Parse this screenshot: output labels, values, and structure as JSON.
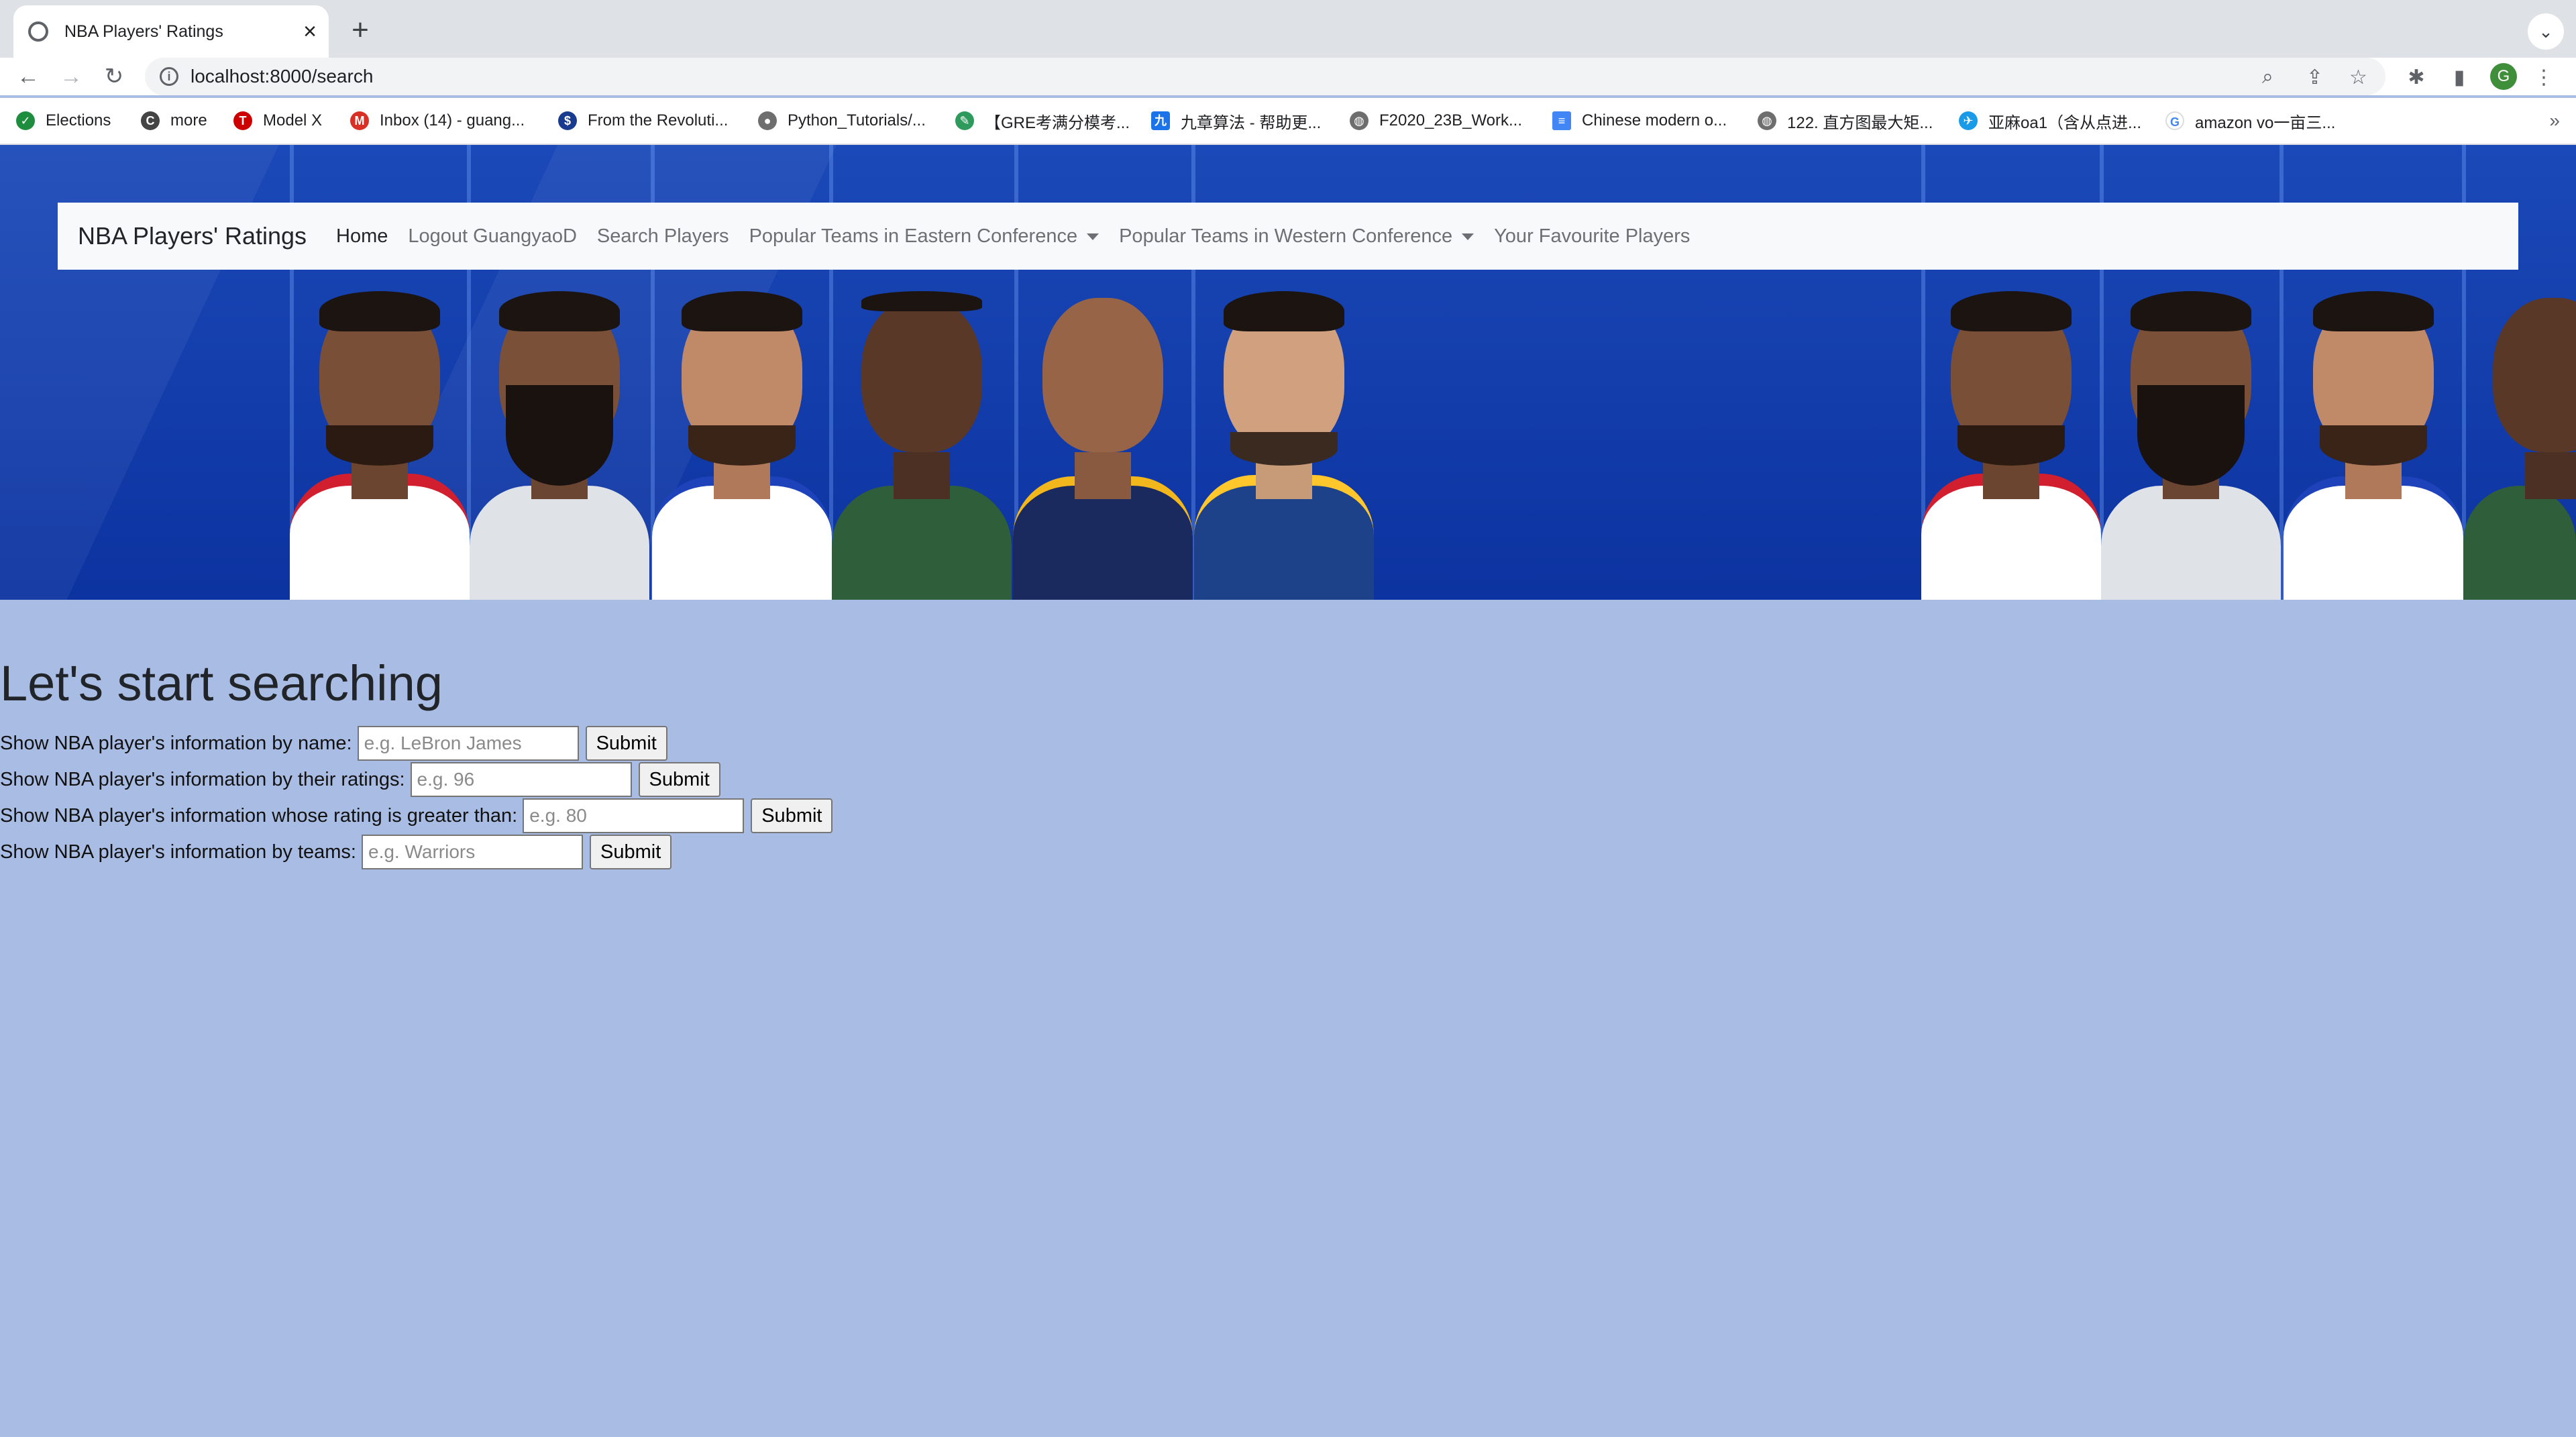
{
  "browser": {
    "tab_title": "NBA Players' Ratings",
    "url": "localhost:8000/search",
    "profile_initial": "G",
    "bookmarks": [
      {
        "label": "Elections",
        "icon": "elections-icon",
        "color": "#1e8e3e"
      },
      {
        "label": "more",
        "icon": "co-icon",
        "color": "#444444"
      },
      {
        "label": "Model X",
        "icon": "tesla-icon",
        "color": "#cc0000"
      },
      {
        "label": "Inbox (14) - guang...",
        "icon": "gmail-icon",
        "color": "#d93025"
      },
      {
        "label": "From the Revoluti...",
        "icon": "dollar-icon",
        "color": "#1a3c8f"
      },
      {
        "label": "Python_Tutorials/...",
        "icon": "github-icon",
        "color": "#6e6e6e"
      },
      {
        "label": "【GRE考满分模考...",
        "icon": "bookmark-leaf-icon",
        "color": "#2e9a5c"
      },
      {
        "label": "九章算法 - 帮助更...",
        "icon": "jiuzhang-icon",
        "color": "#1a73e8"
      },
      {
        "label": "F2020_23B_Work...",
        "icon": "globe-icon",
        "color": "#6e6e6e"
      },
      {
        "label": "Chinese modern o...",
        "icon": "docs-icon",
        "color": "#4285f4"
      },
      {
        "label": "122. 直方图最大矩...",
        "icon": "globe-icon",
        "color": "#6e6e6e"
      },
      {
        "label": "亚麻oa1（含从点进...",
        "icon": "bird-icon",
        "color": "#1a9be8"
      },
      {
        "label": "amazon vo一亩三...",
        "icon": "google-icon",
        "color": "#4285f4"
      }
    ]
  },
  "navbar": {
    "brand": "NBA Players' Ratings",
    "links": {
      "home": "Home",
      "logout": "Logout GuangyaoD",
      "search": "Search Players",
      "east": "Popular Teams in Eastern Conference",
      "west": "Popular Teams in Western Conference",
      "favourites": "Your Favourite Players"
    }
  },
  "main": {
    "heading": "Let's start searching",
    "forms": [
      {
        "label": "Show NBA player's information by name:",
        "placeholder": "e.g. LeBron James",
        "button": "Submit"
      },
      {
        "label": "Show NBA player's information by their ratings:",
        "placeholder": "e.g. 96",
        "button": "Submit"
      },
      {
        "label": "Show NBA player's information whose rating is greater than:",
        "placeholder": "e.g. 80",
        "button": "Submit"
      },
      {
        "label": "Show NBA player's information by teams:",
        "placeholder": "e.g. Warriors",
        "button": "Submit"
      }
    ]
  },
  "colors": {
    "page_background": "#a9bde4",
    "banner_blue": "#1b49b8",
    "navbar_background": "#f8f9fa"
  }
}
